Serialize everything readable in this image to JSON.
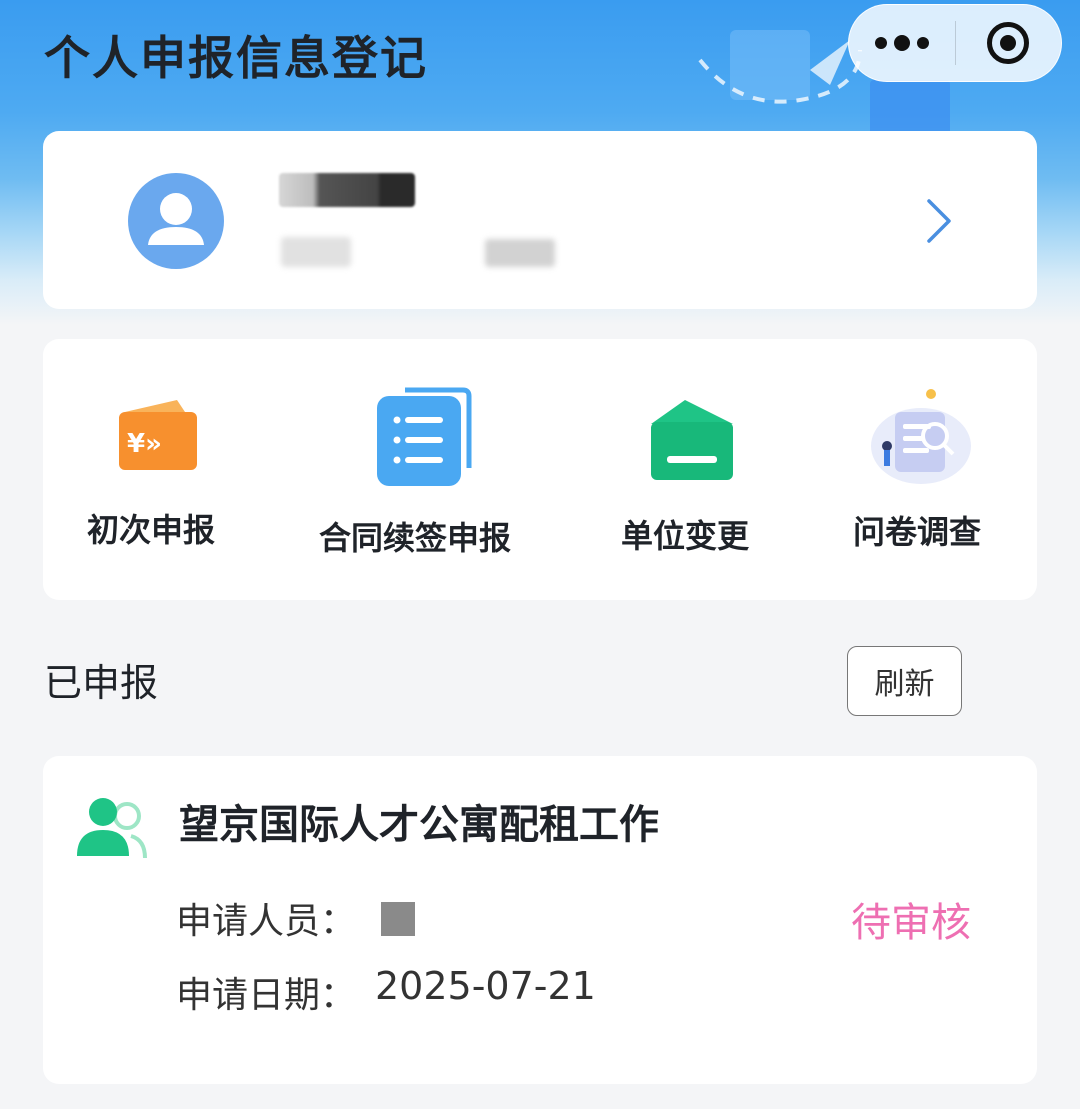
{
  "header": {
    "title": "个人申报信息登记"
  },
  "menu": {
    "items": [
      {
        "label": "初次申报",
        "icon": "yuan-card-icon"
      },
      {
        "label": "合同续签申报",
        "icon": "document-list-icon"
      },
      {
        "label": "单位变更",
        "icon": "folder-icon"
      },
      {
        "label": "问卷调查",
        "icon": "survey-search-icon"
      }
    ]
  },
  "submitted": {
    "section_title": "已申报",
    "refresh_label": "刷新",
    "records": [
      {
        "title": "望京国际人才公寓配租工作",
        "applicant_label": "申请人员：",
        "date_label": "申请日期：",
        "date": "2025-07-21",
        "status": "待审核"
      }
    ]
  },
  "colors": {
    "primary_blue": "#3a9cf0",
    "status_pink": "#ee6fb2",
    "green": "#1fc486",
    "orange": "#f7902e"
  }
}
